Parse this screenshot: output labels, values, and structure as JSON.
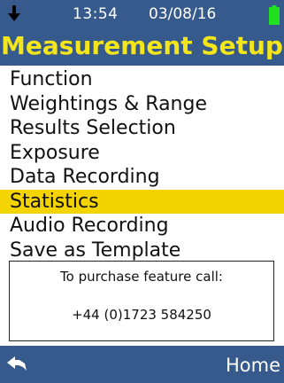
{
  "status": {
    "time": "13:54",
    "date": "03/08/16",
    "left_icon": "down-arrow-icon",
    "battery_icon": "battery-icon",
    "battery_color": "#20e020"
  },
  "header": {
    "title": "Measurement Setup",
    "title_color": "#f4e61a",
    "background": "#365a8c"
  },
  "menu": {
    "items": [
      {
        "label": "Function",
        "selected": false
      },
      {
        "label": "Weightings & Range",
        "selected": false
      },
      {
        "label": "Results Selection",
        "selected": false
      },
      {
        "label": "Exposure",
        "selected": false
      },
      {
        "label": "Data Recording",
        "selected": false
      },
      {
        "label": "Statistics",
        "selected": true
      },
      {
        "label": "Audio Recording",
        "selected": false
      },
      {
        "label": "Save as Template",
        "selected": false
      }
    ],
    "selected_color": "#f3d400"
  },
  "info": {
    "line1": "To purchase feature call:",
    "line2": "+44 (0)1723 584250"
  },
  "footer": {
    "back_icon": "back-arrow-icon",
    "home_label": "Home"
  }
}
